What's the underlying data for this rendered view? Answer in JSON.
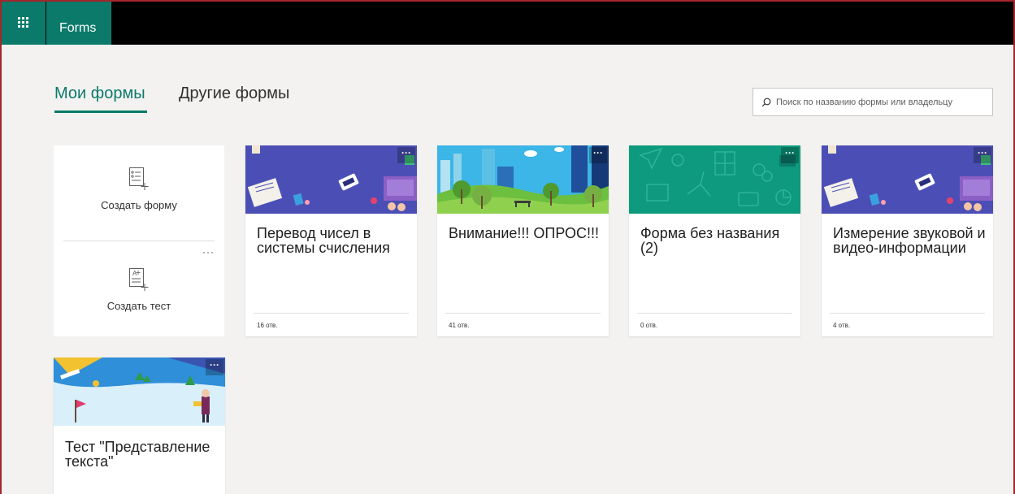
{
  "app": {
    "name": "Forms"
  },
  "tabs": [
    {
      "label": "Мои формы",
      "active": true
    },
    {
      "label": "Другие формы",
      "active": false
    }
  ],
  "search": {
    "placeholder": "Поиск по названию формы или владельцу"
  },
  "create": {
    "form_label": "Создать форму",
    "quiz_label": "Создать тест",
    "more_label": "···"
  },
  "forms": [
    {
      "title": "Перевод чисел в системы счисления",
      "responses": "16 отв.",
      "banner": "purple-office",
      "more_label": "···"
    },
    {
      "title": "Внимание!!! ОПРОС!!!",
      "responses": "41 отв.",
      "banner": "city-park",
      "more_label": "···"
    },
    {
      "title": "Форма без названия (2)",
      "responses": "0 отв.",
      "banner": "teal-doodle",
      "more_label": "···"
    },
    {
      "title": "Измерение звуковой и видео-информации",
      "responses": "4 отв.",
      "banner": "purple-office",
      "more_label": "···"
    },
    {
      "title": "Тест \"Представление текста\"",
      "responses": "",
      "banner": "snow-ski",
      "more_label": "···"
    }
  ],
  "colors": {
    "accent": "#0b7a6a",
    "topbar": "#000000",
    "background": "#f3f2f1",
    "frame": "#a4262c"
  }
}
